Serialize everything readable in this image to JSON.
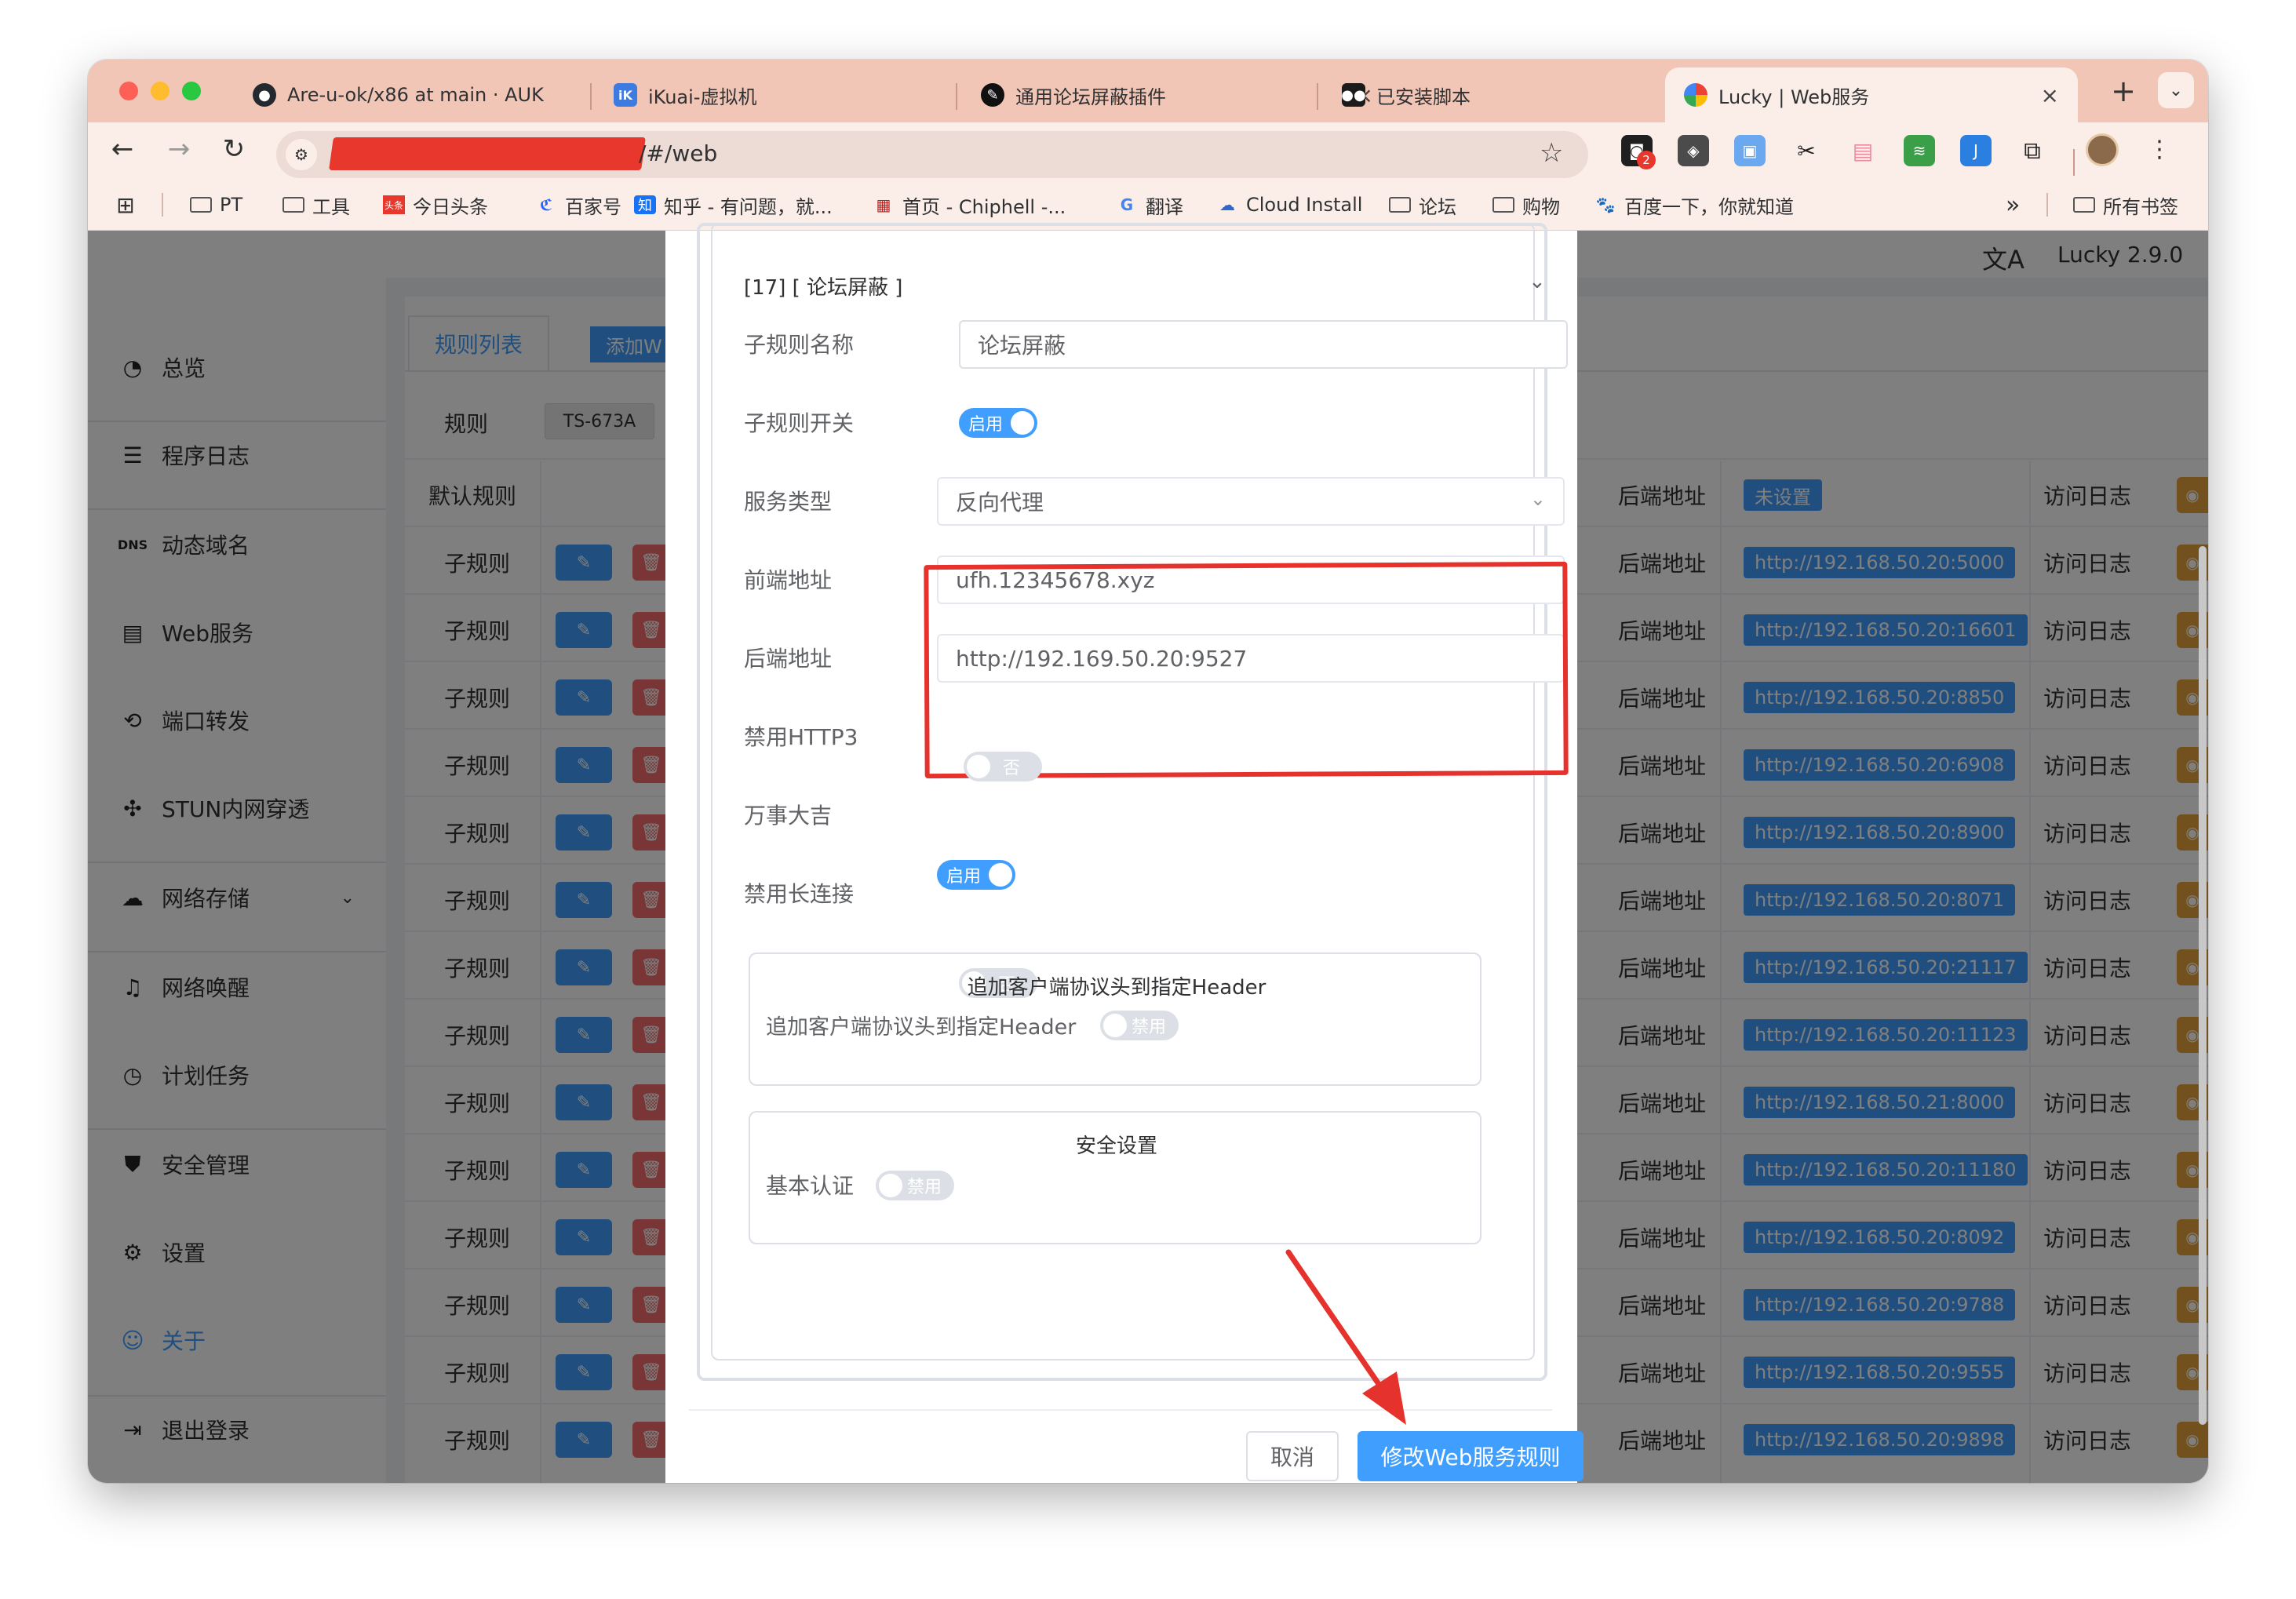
{
  "browser": {
    "tabs": [
      {
        "title": "Are-u-ok/x86 at main · AUK",
        "icon": "github-icon"
      },
      {
        "title": "iKuai-虚拟机",
        "icon": "ikuai-icon"
      },
      {
        "title": "通用论坛屏蔽插件",
        "icon": "plugin-icon"
      },
      {
        "title": "已安装脚本",
        "icon": "tampermonkey-icon"
      },
      {
        "title": "Lucky | Web服务",
        "icon": "lucky-icon",
        "active": true
      }
    ],
    "url": "/#/web",
    "extension_badge": "2",
    "bookmarks": [
      {
        "label": "PT",
        "icon": "folder-icon"
      },
      {
        "label": "工具",
        "icon": "folder-icon"
      },
      {
        "label": "今日头条",
        "icon": "toutiao-icon"
      },
      {
        "label": "百家号",
        "icon": "baijiahao-icon"
      },
      {
        "label": "知乎 - 有问题，就...",
        "icon": "zhihu-icon"
      },
      {
        "label": "首页 - Chiphell -...",
        "icon": "chiphell-icon"
      },
      {
        "label": "翻译",
        "icon": "translate-icon"
      },
      {
        "label": "Cloud Install",
        "icon": "cloud-icon"
      },
      {
        "label": "论坛",
        "icon": "folder-icon"
      },
      {
        "label": "购物",
        "icon": "folder-icon"
      },
      {
        "label": "百度一下，你就知道",
        "icon": "baidu-icon"
      }
    ],
    "bookmarks_more": "»",
    "all_bookmarks": "所有书签"
  },
  "app": {
    "version": "Lucky 2.9.0",
    "sidebar": [
      {
        "label": "总览",
        "icon": "dashboard-icon"
      },
      {
        "label": "程序日志",
        "icon": "log-icon"
      },
      {
        "label": "动态域名",
        "icon": "ddns-icon"
      },
      {
        "label": "Web服务",
        "icon": "web-icon"
      },
      {
        "label": "端口转发",
        "icon": "port-forward-icon"
      },
      {
        "label": "STUN内网穿透",
        "icon": "stun-icon"
      },
      {
        "label": "网络存储",
        "icon": "cloud-storage-icon"
      },
      {
        "label": "网络唤醒",
        "icon": "bell-icon"
      },
      {
        "label": "计划任务",
        "icon": "clock-icon"
      },
      {
        "label": "安全管理",
        "icon": "shield-icon"
      },
      {
        "label": "设置",
        "icon": "gear-icon"
      },
      {
        "label": "关于",
        "icon": "about-icon"
      },
      {
        "label": "退出登录",
        "icon": "logout-icon"
      }
    ],
    "tabs": {
      "rules_list": "规则列表",
      "add": "添加W"
    },
    "rule_label": "规则",
    "rule_name": "TS-673A",
    "default_rule": "默认规则",
    "backend_label": "后端地址",
    "not_set": "未设置",
    "access_log": "访问日志",
    "sub_rule": "子规则",
    "backends": [
      "http://192.168.50.20:5000",
      "http://192.168.50.20:16601",
      "http://192.168.50.20:8850",
      "http://192.168.50.20:6908",
      "http://192.168.50.20:8900",
      "http://192.168.50.20:8071",
      "http://192.168.50.20:21117",
      "http://192.168.50.20:11123",
      "http://192.168.50.21:8000",
      "http://192.168.50.20:11180",
      "http://192.168.50.20:8092",
      "http://192.168.50.20:9788",
      "http://192.168.50.20:9555",
      "http://192.168.50.20:9898"
    ]
  },
  "dialog": {
    "section_title": "[17] [ 论坛屏蔽 ]",
    "name_label": "子规则名称",
    "name_value": "论坛屏蔽",
    "enable_label": "子规则开关",
    "enable_on": "启用",
    "service_type_label": "服务类型",
    "service_type_value": "反向代理",
    "frontend_label": "前端地址",
    "frontend_value": "ufh.12345678.xyz",
    "backend_label": "后端地址",
    "backend_value": "http://192.169.50.20:9527",
    "http3_label": "禁用HTTP3",
    "http3_off": "否",
    "wanshi_label": "万事大吉",
    "wanshi_on": "启用",
    "keepalive_label": "禁用长连接",
    "keepalive_off": "否",
    "header_panel_title": "追加客户端协议头到指定Header",
    "header_label": "追加客户端协议头到指定Header",
    "header_off": "禁用",
    "security_title": "安全设置",
    "basic_auth_label": "基本认证",
    "basic_auth_off": "禁用",
    "cancel": "取消",
    "submit": "修改Web服务规则"
  },
  "colors": {
    "accent": "#409eff",
    "annotation": "#e5322d",
    "tabstrip": "#f2c6b6"
  }
}
